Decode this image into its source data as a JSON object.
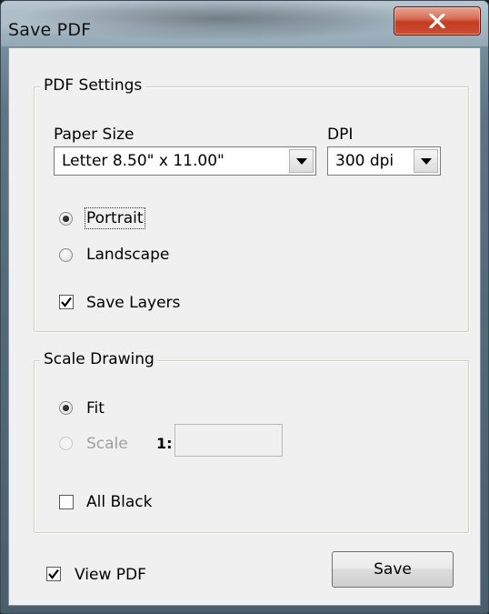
{
  "window": {
    "title": "Save PDF",
    "close_icon": "close-x-icon",
    "accent_close_color": "#c43b1f"
  },
  "pdf_settings": {
    "legend": "PDF Settings",
    "paper_size_label": "Paper Size",
    "paper_size_value": "Letter  8.50\" x 11.00\"",
    "dpi_label": "DPI",
    "dpi_value": "300 dpi",
    "orientation": {
      "portrait_label": "Portrait",
      "landscape_label": "Landscape",
      "selected": "Portrait"
    },
    "save_layers_label": "Save Layers",
    "save_layers_checked": true
  },
  "scale_drawing": {
    "legend": "Scale Drawing",
    "fit_label": "Fit",
    "scale_label": "Scale",
    "scale_prefix": "1:",
    "scale_value": "",
    "selected": "Fit",
    "all_black_label": "All Black",
    "all_black_checked": false
  },
  "footer": {
    "view_pdf_label": "View PDF",
    "view_pdf_checked": true,
    "save_label": "Save"
  }
}
